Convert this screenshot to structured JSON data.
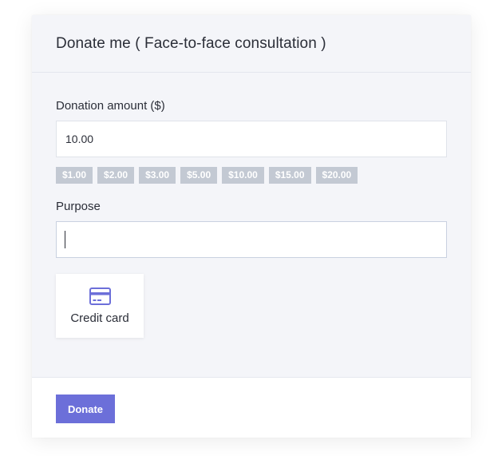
{
  "modal": {
    "title": "Donate me ( Face-to-face consultation )"
  },
  "amount": {
    "label": "Donation amount ($)",
    "value": "10.00",
    "presets": [
      "$1.00",
      "$2.00",
      "$3.00",
      "$5.00",
      "$10.00",
      "$15.00",
      "$20.00"
    ]
  },
  "purpose": {
    "label": "Purpose",
    "value": ""
  },
  "payment_methods": [
    {
      "label": "Credit card",
      "icon": "credit-card-icon",
      "color": "#6c6fd9"
    }
  ],
  "footer": {
    "donate_label": "Donate",
    "button_color": "#6c6fd9"
  }
}
